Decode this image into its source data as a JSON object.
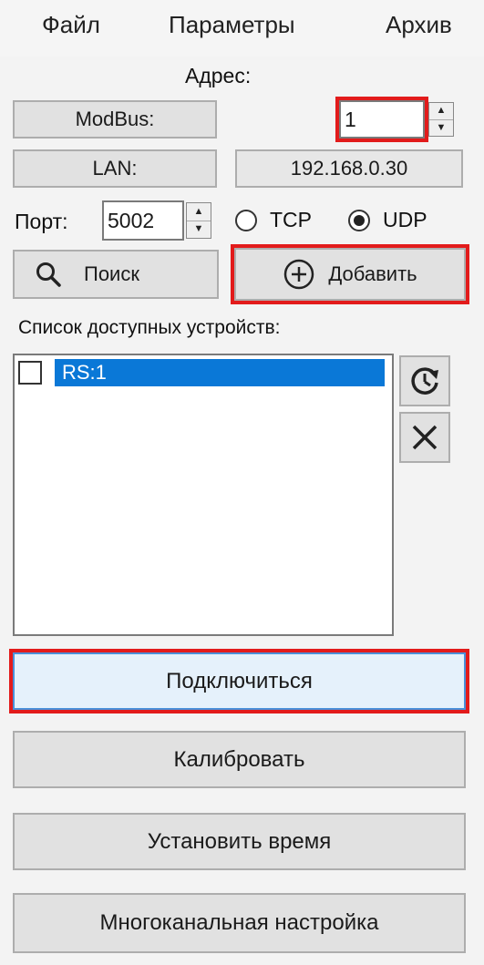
{
  "menu": {
    "items": [
      "Файл",
      "Параметры",
      "Архив"
    ]
  },
  "address": {
    "label": "Адрес:",
    "modbus_button": "ModBus:",
    "modbus_value": "1",
    "lan_button": "LAN:",
    "ip_value": "192.168.0.30"
  },
  "port": {
    "label": "Порт:",
    "value": "5002",
    "protocols": [
      {
        "label": "TCP",
        "selected": false
      },
      {
        "label": "UDP",
        "selected": true
      }
    ]
  },
  "actions": {
    "search_label": "Поиск",
    "add_label": "Добавить"
  },
  "devices": {
    "label": "Список доступных устройств:",
    "items": [
      {
        "name": "RS:1",
        "checked": false,
        "selected": true
      }
    ]
  },
  "buttons": {
    "connect": "Подключиться",
    "calibrate": "Калибровать",
    "set_time": "Установить время",
    "multichannel": "Многоканальная настройка"
  },
  "colors": {
    "highlight": "#e21b1b",
    "selection": "#0a78d7",
    "connect_bg": "#e5f1fb"
  },
  "icons": {
    "search": "magnifier-icon",
    "add": "plus-circle-icon",
    "refresh": "refresh-icon",
    "delete": "close-icon"
  }
}
